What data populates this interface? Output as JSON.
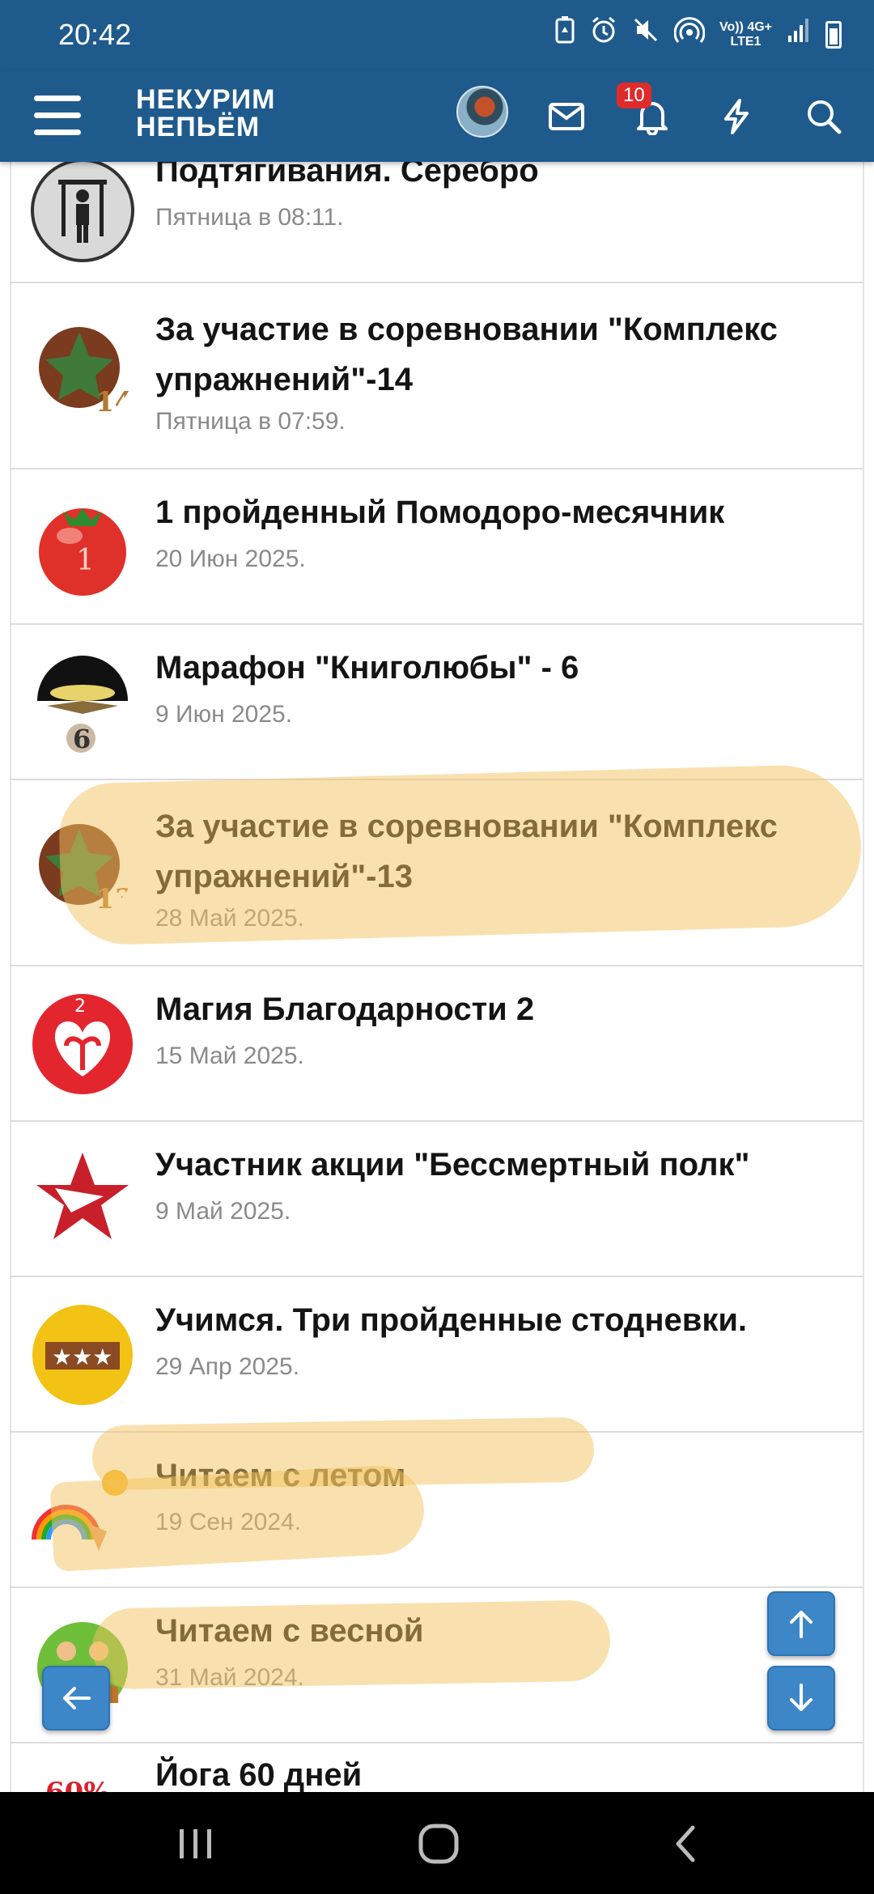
{
  "status": {
    "time": "20:42",
    "network_label_top": "Vo)) 4G+",
    "network_label_bottom": "LTE1"
  },
  "header": {
    "logo_line1": "НЕКУРИМ",
    "logo_line2": "НЕПЬЁМ",
    "notification_count": "10"
  },
  "achievements": [
    {
      "title": "Подтягивания. Серебро",
      "date": "Пятница в 08:11.",
      "icon": "pullup-silver-icon"
    },
    {
      "title": "За участие в соревновании \"Комплекс упражнений\"-14",
      "date": "Пятница в 07:59.",
      "icon": "exercise-complex-14-icon"
    },
    {
      "title": "1 пройденный Помодоро-месячник",
      "date": "20 Июн 2025.",
      "icon": "tomato-icon"
    },
    {
      "title": "Марафон \"Книголюбы\" - 6",
      "date": "9 Июн 2025.",
      "icon": "book-marathon-icon"
    },
    {
      "title": "За участие в соревновании \"Комплекс упражнений\"-13",
      "date": "28 Май 2025.",
      "icon": "exercise-complex-13-icon"
    },
    {
      "title": "Магия Благодарности 2",
      "date": "15 Май 2025.",
      "icon": "gratitude-heart-icon"
    },
    {
      "title": "Участник акции \"Бессмертный полк\"",
      "date": "9 Май 2025.",
      "icon": "red-star-icon"
    },
    {
      "title": "Учимся. Три пройденные стодневки.",
      "date": "29 Апр 2025.",
      "icon": "three-stars-icon"
    },
    {
      "title": "Читаем с летом",
      "date": "19 Сен 2024.",
      "icon": "rainbow-sun-icon"
    },
    {
      "title": "Читаем с весной",
      "date": "31 Май 2024.",
      "icon": "spring-reading-icon"
    },
    {
      "title": "Йога 60 дней",
      "date": "",
      "icon": "yoga-60-icon"
    }
  ],
  "colors": {
    "header_bg": "#1f5a8c",
    "highlight": "#f4c460",
    "fab": "#3d87c9"
  }
}
